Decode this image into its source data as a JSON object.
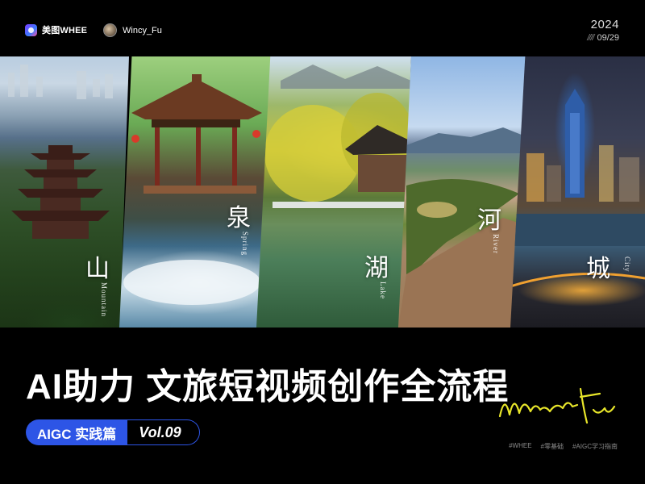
{
  "header": {
    "brand": "美图WHEE",
    "author": "Wincy_Fu",
    "year": "2024",
    "date": "09/29",
    "date_marker": "////"
  },
  "panels": [
    {
      "char": "山",
      "sub": "Mountain"
    },
    {
      "char": "泉",
      "sub": "Spring"
    },
    {
      "char": "湖",
      "sub": "Lake"
    },
    {
      "char": "河",
      "sub": "River"
    },
    {
      "char": "城",
      "sub": "City"
    }
  ],
  "title": "AI助力 文旅短视频创作全流程",
  "tag": {
    "label": "AIGC 实践篇",
    "vol": "Vol.09"
  },
  "signature": "Wincy Fu",
  "hashtags": [
    "#WHEE",
    "#零基础",
    "#AIGC学习指南"
  ],
  "colors": {
    "accent": "#2d55e6",
    "signature": "#e8e62a",
    "background": "#000000"
  }
}
